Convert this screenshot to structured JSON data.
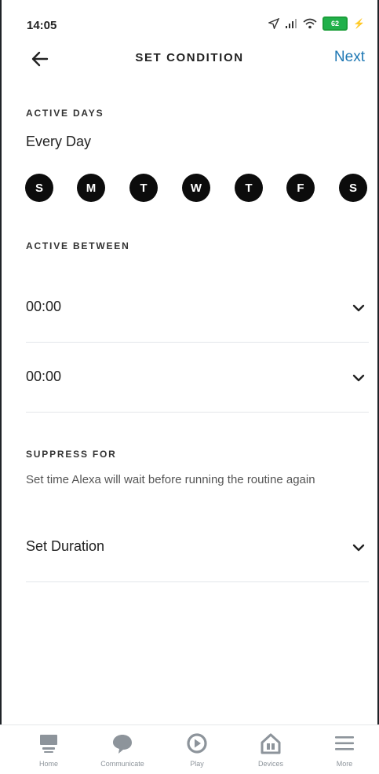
{
  "status_bar": {
    "time": "14:05",
    "battery": "62"
  },
  "header": {
    "title": "SET CONDITION",
    "next_label": "Next"
  },
  "active_days": {
    "label": "ACTIVE DAYS",
    "value": "Every Day",
    "days": [
      "S",
      "M",
      "T",
      "W",
      "T",
      "F",
      "S"
    ]
  },
  "active_between": {
    "label": "ACTIVE BETWEEN",
    "start_time": "00:00",
    "end_time": "00:00"
  },
  "suppress": {
    "label": "SUPPRESS FOR",
    "helper": "Set time Alexa will wait before running the routine again",
    "duration_value": "Set Duration"
  },
  "bottom_nav": {
    "items": [
      {
        "label": "Home",
        "icon": "home-icon"
      },
      {
        "label": "Communicate",
        "icon": "chat-bubble-icon"
      },
      {
        "label": "Play",
        "icon": "play-icon"
      },
      {
        "label": "Devices",
        "icon": "devices-icon"
      },
      {
        "label": "More",
        "icon": "menu-icon"
      }
    ]
  },
  "colors": {
    "accent": "#1f78b4",
    "day_fill": "#0c0c0c",
    "nav_icon": "#8d949b",
    "divider": "#e3e6ea"
  }
}
